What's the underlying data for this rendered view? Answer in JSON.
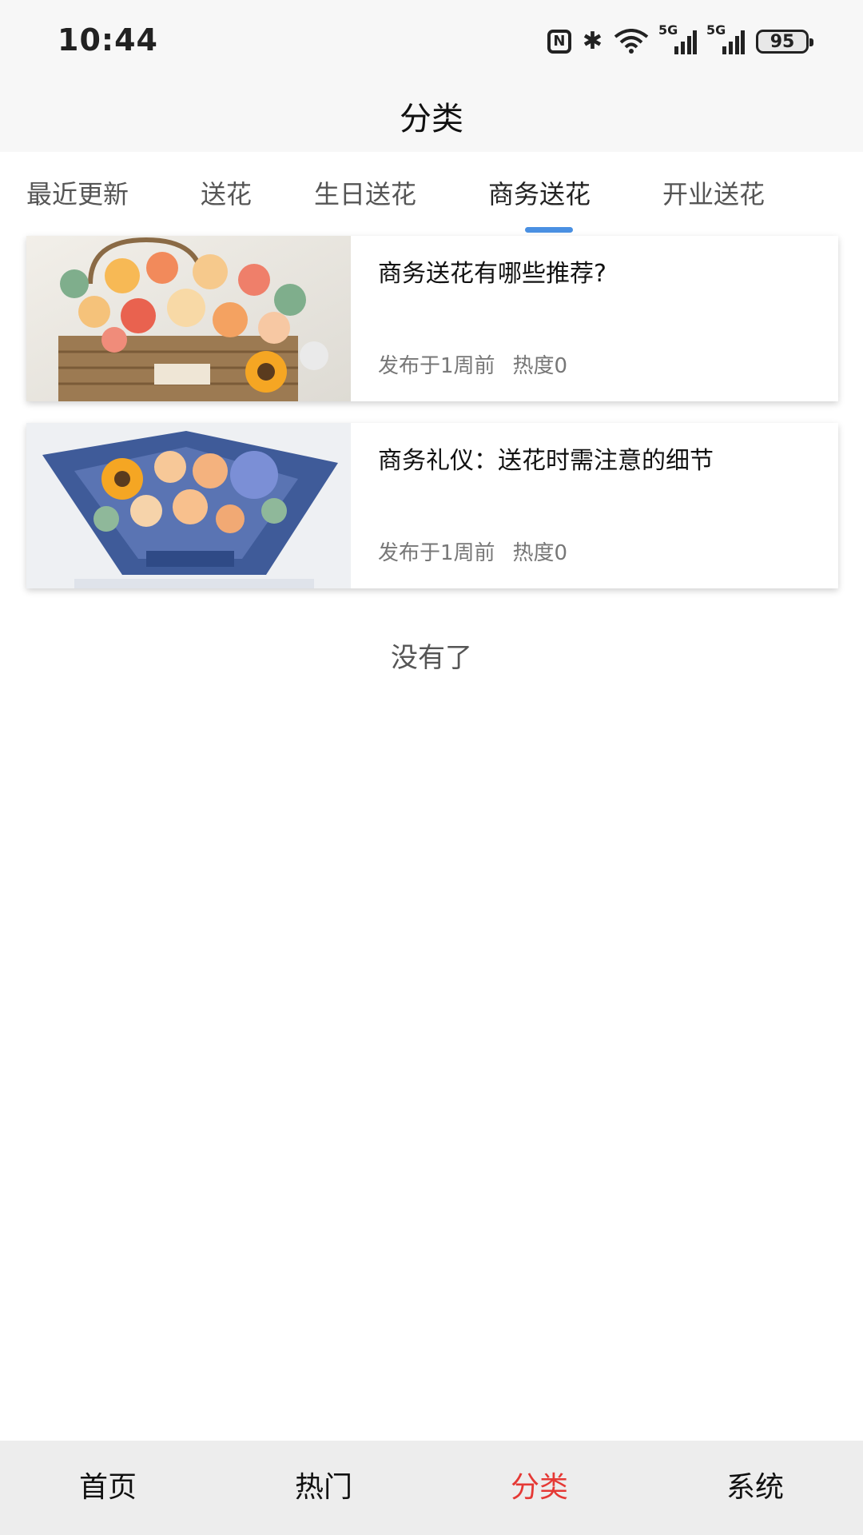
{
  "status_bar": {
    "time": "10:44",
    "network_tag_1": "5G",
    "network_tag_2": "5G",
    "battery": "95",
    "icons": [
      "nfc-icon",
      "bluetooth-icon",
      "wifi-icon",
      "signal-icon",
      "signal-icon",
      "battery-icon"
    ]
  },
  "header": {
    "title": "分类"
  },
  "tabs": [
    {
      "label": "最近更新",
      "active": false
    },
    {
      "label": "送花",
      "active": false
    },
    {
      "label": "生日送花",
      "active": false
    },
    {
      "label": "商务送花",
      "active": true
    },
    {
      "label": "开业送花",
      "active": false
    }
  ],
  "articles": [
    {
      "title": "商务送花有哪些推荐?",
      "published": "发布于1周前",
      "heat": "热度0"
    },
    {
      "title": "商务礼仪：送花时需注意的细节",
      "published": "发布于1周前",
      "heat": "热度0"
    }
  ],
  "list_end_text": "没有了",
  "bottom_nav": [
    {
      "label": "首页",
      "active": false
    },
    {
      "label": "热门",
      "active": false
    },
    {
      "label": "分类",
      "active": true
    },
    {
      "label": "系统",
      "active": false
    }
  ],
  "colors": {
    "accent_tab": "#4a90e2",
    "active_nav": "#e53935"
  }
}
